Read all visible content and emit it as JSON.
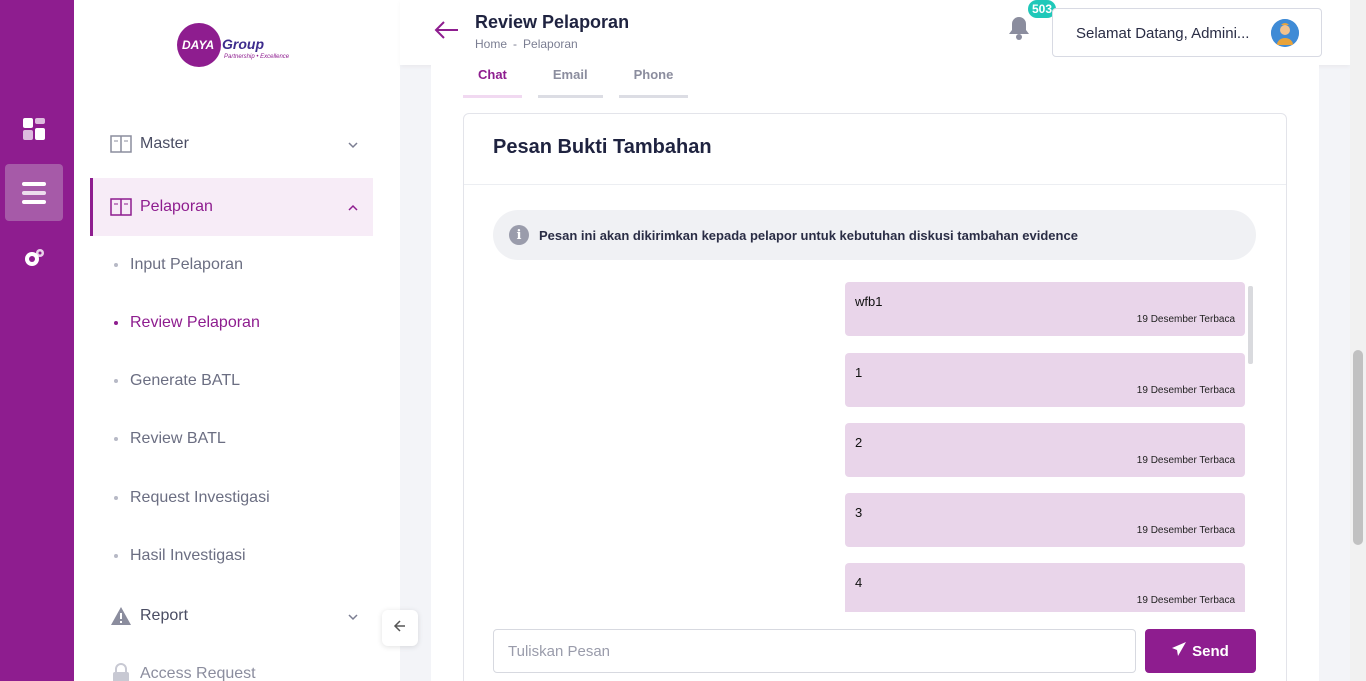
{
  "brand": {
    "logo_main": "DAYA Group",
    "logo_tagline": "Partnership • Excellence",
    "color": "#8e1d8f"
  },
  "rail": {
    "items": [
      {
        "icon": "dashboard-grid-icon"
      },
      {
        "icon": "menu-list-icon",
        "active": true
      },
      {
        "icon": "settings-gear-icon"
      }
    ]
  },
  "sidebar": {
    "items": [
      {
        "label": "Master",
        "icon": "book-icon"
      },
      {
        "label": "Pelaporan",
        "icon": "book-icon",
        "active": true
      },
      {
        "label": "Report",
        "icon": "warning-icon"
      },
      {
        "label": "Access Request",
        "icon": "lock-icon"
      }
    ],
    "subitems": [
      {
        "label": "Input Pelaporan"
      },
      {
        "label": "Review Pelaporan",
        "active": true
      },
      {
        "label": "Generate BATL"
      },
      {
        "label": "Review BATL"
      },
      {
        "label": "Request Investigasi"
      },
      {
        "label": "Hasil Investigasi"
      }
    ]
  },
  "header": {
    "title": "Review Pelaporan",
    "breadcrumb": [
      "Home",
      "-",
      "Pelaporan"
    ],
    "notification_count": "503",
    "greeting": "Selamat Datang, Admini..."
  },
  "tabs": [
    {
      "label": "Chat",
      "active": true
    },
    {
      "label": "Email"
    },
    {
      "label": "Phone"
    }
  ],
  "panel": {
    "title": "Pesan Bukti Tambahan",
    "info": "Pesan ini akan dikirimkan kepada pelapor untuk kebutuhan diskusi tambahan evidence"
  },
  "messages": [
    {
      "text": "wfb1",
      "meta": "19 Desember Terbaca"
    },
    {
      "text": "1",
      "meta": "19 Desember Terbaca"
    },
    {
      "text": "2",
      "meta": "19 Desember Terbaca"
    },
    {
      "text": "3",
      "meta": "19 Desember Terbaca"
    },
    {
      "text": "4",
      "meta": "19 Desember Terbaca"
    }
  ],
  "composer": {
    "placeholder": "Tuliskan Pesan",
    "send_label": "Send"
  }
}
